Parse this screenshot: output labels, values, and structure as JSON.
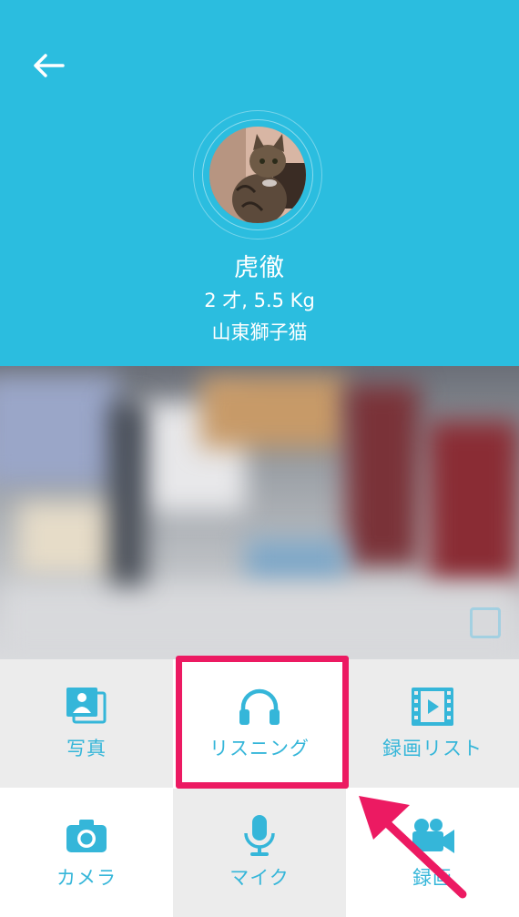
{
  "header": {
    "back_icon": "arrow-left-icon",
    "pet_name": "虎徹",
    "pet_info": "2 才, 5.5 Kg",
    "pet_breed": "山東獅子猫",
    "background_color": "#2bbddf"
  },
  "controls": [
    {
      "id": "photo",
      "label": "写真",
      "icon": "photo-album-icon"
    },
    {
      "id": "listening",
      "label": "リスニング",
      "icon": "headphones-icon"
    },
    {
      "id": "recording-list",
      "label": "録画リスト",
      "icon": "film-strip-icon"
    },
    {
      "id": "camera",
      "label": "カメラ",
      "icon": "camera-icon"
    },
    {
      "id": "mic",
      "label": "マイク",
      "icon": "microphone-icon"
    },
    {
      "id": "record",
      "label": "録画",
      "icon": "video-camera-icon"
    }
  ],
  "accent_color": "#35b6d9",
  "highlight_color": "#ec1a62"
}
